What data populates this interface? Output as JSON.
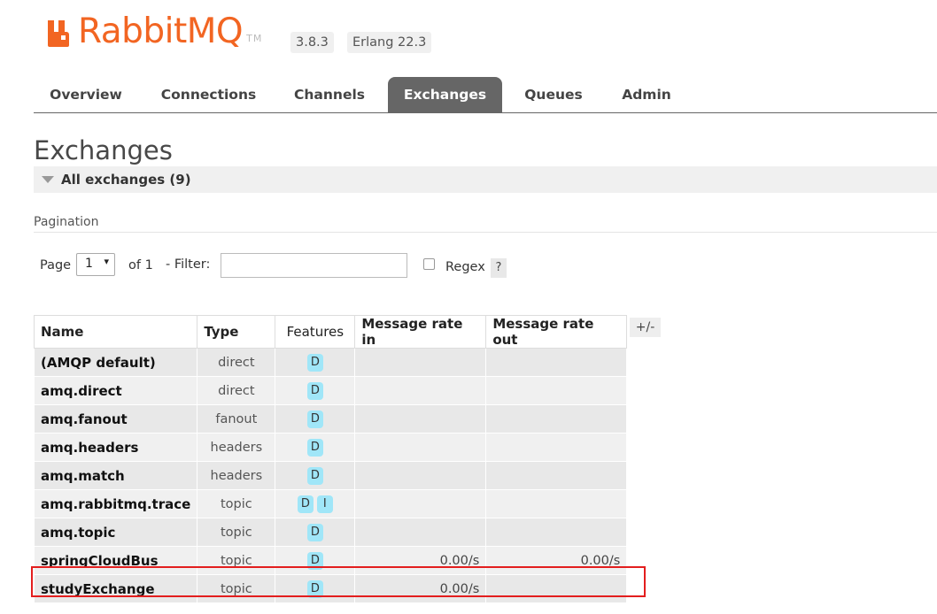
{
  "brand": {
    "logo_text": "RabbitMQ",
    "trademark": "TM",
    "version": "3.8.3",
    "erlang": "Erlang 22.3",
    "color": "#f26522"
  },
  "tabs": [
    {
      "label": "Overview",
      "active": false
    },
    {
      "label": "Connections",
      "active": false
    },
    {
      "label": "Channels",
      "active": false
    },
    {
      "label": "Exchanges",
      "active": true
    },
    {
      "label": "Queues",
      "active": false
    },
    {
      "label": "Admin",
      "active": false
    }
  ],
  "page": {
    "title": "Exchanges",
    "section_title": "All exchanges (9)"
  },
  "pagination": {
    "label": "Pagination",
    "page_word": "Page",
    "page_value": "1",
    "of_label": "of 1",
    "filter_label": "- Filter:",
    "filter_value": "",
    "regex_label": "Regex",
    "regex_checked": false,
    "help_label": "?"
  },
  "table": {
    "headers": [
      "Name",
      "Type",
      "Features",
      "Message rate in",
      "Message rate out"
    ],
    "toggle_columns_label": "+/-",
    "rows": [
      {
        "name": "(AMQP default)",
        "type": "direct",
        "features": [
          "D"
        ],
        "rate_in": "",
        "rate_out": ""
      },
      {
        "name": "amq.direct",
        "type": "direct",
        "features": [
          "D"
        ],
        "rate_in": "",
        "rate_out": ""
      },
      {
        "name": "amq.fanout",
        "type": "fanout",
        "features": [
          "D"
        ],
        "rate_in": "",
        "rate_out": ""
      },
      {
        "name": "amq.headers",
        "type": "headers",
        "features": [
          "D"
        ],
        "rate_in": "",
        "rate_out": ""
      },
      {
        "name": "amq.match",
        "type": "headers",
        "features": [
          "D"
        ],
        "rate_in": "",
        "rate_out": ""
      },
      {
        "name": "amq.rabbitmq.trace",
        "type": "topic",
        "features": [
          "D",
          "I"
        ],
        "rate_in": "",
        "rate_out": ""
      },
      {
        "name": "amq.topic",
        "type": "topic",
        "features": [
          "D"
        ],
        "rate_in": "",
        "rate_out": ""
      },
      {
        "name": "springCloudBus",
        "type": "topic",
        "features": [
          "D"
        ],
        "rate_in": "0.00/s",
        "rate_out": "0.00/s"
      },
      {
        "name": "studyExchange",
        "type": "topic",
        "features": [
          "D"
        ],
        "rate_in": "0.00/s",
        "rate_out": ""
      }
    ]
  },
  "colors": {
    "feature_badge": "#a0e6f8",
    "active_tab": "#666666",
    "highlight": "#e31e1e"
  }
}
